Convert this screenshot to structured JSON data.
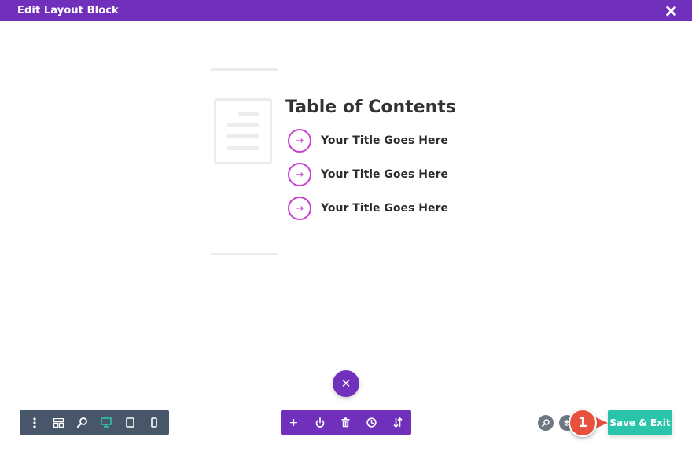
{
  "modal": {
    "title": "Edit Layout Block"
  },
  "toc": {
    "heading": "Table of Contents",
    "arrow": "→",
    "items": [
      {
        "label": "Your Title Goes Here"
      },
      {
        "label": "Your Title Goes Here"
      },
      {
        "label": "Your Title Goes Here"
      }
    ]
  },
  "fab": {
    "close_glyph": "✕"
  },
  "left_toolbar": {
    "icons": [
      "more-vertical-icon",
      "wireframe-icon",
      "zoom-icon",
      "desktop-icon",
      "tablet-icon",
      "phone-icon"
    ],
    "active": "desktop-icon"
  },
  "mid_toolbar": {
    "icons": [
      "add-icon",
      "portability-icon",
      "trash-icon",
      "history-icon",
      "sort-icon"
    ],
    "glyphs": {
      "add": "+"
    }
  },
  "callout": {
    "number": "1"
  },
  "save_exit": {
    "label": "Save & Exit"
  },
  "colors": {
    "header": "#7130bb",
    "accent": "#c93ed0",
    "save": "#29c4a9",
    "toolbar": "#475669",
    "callout": "#e8513e"
  }
}
